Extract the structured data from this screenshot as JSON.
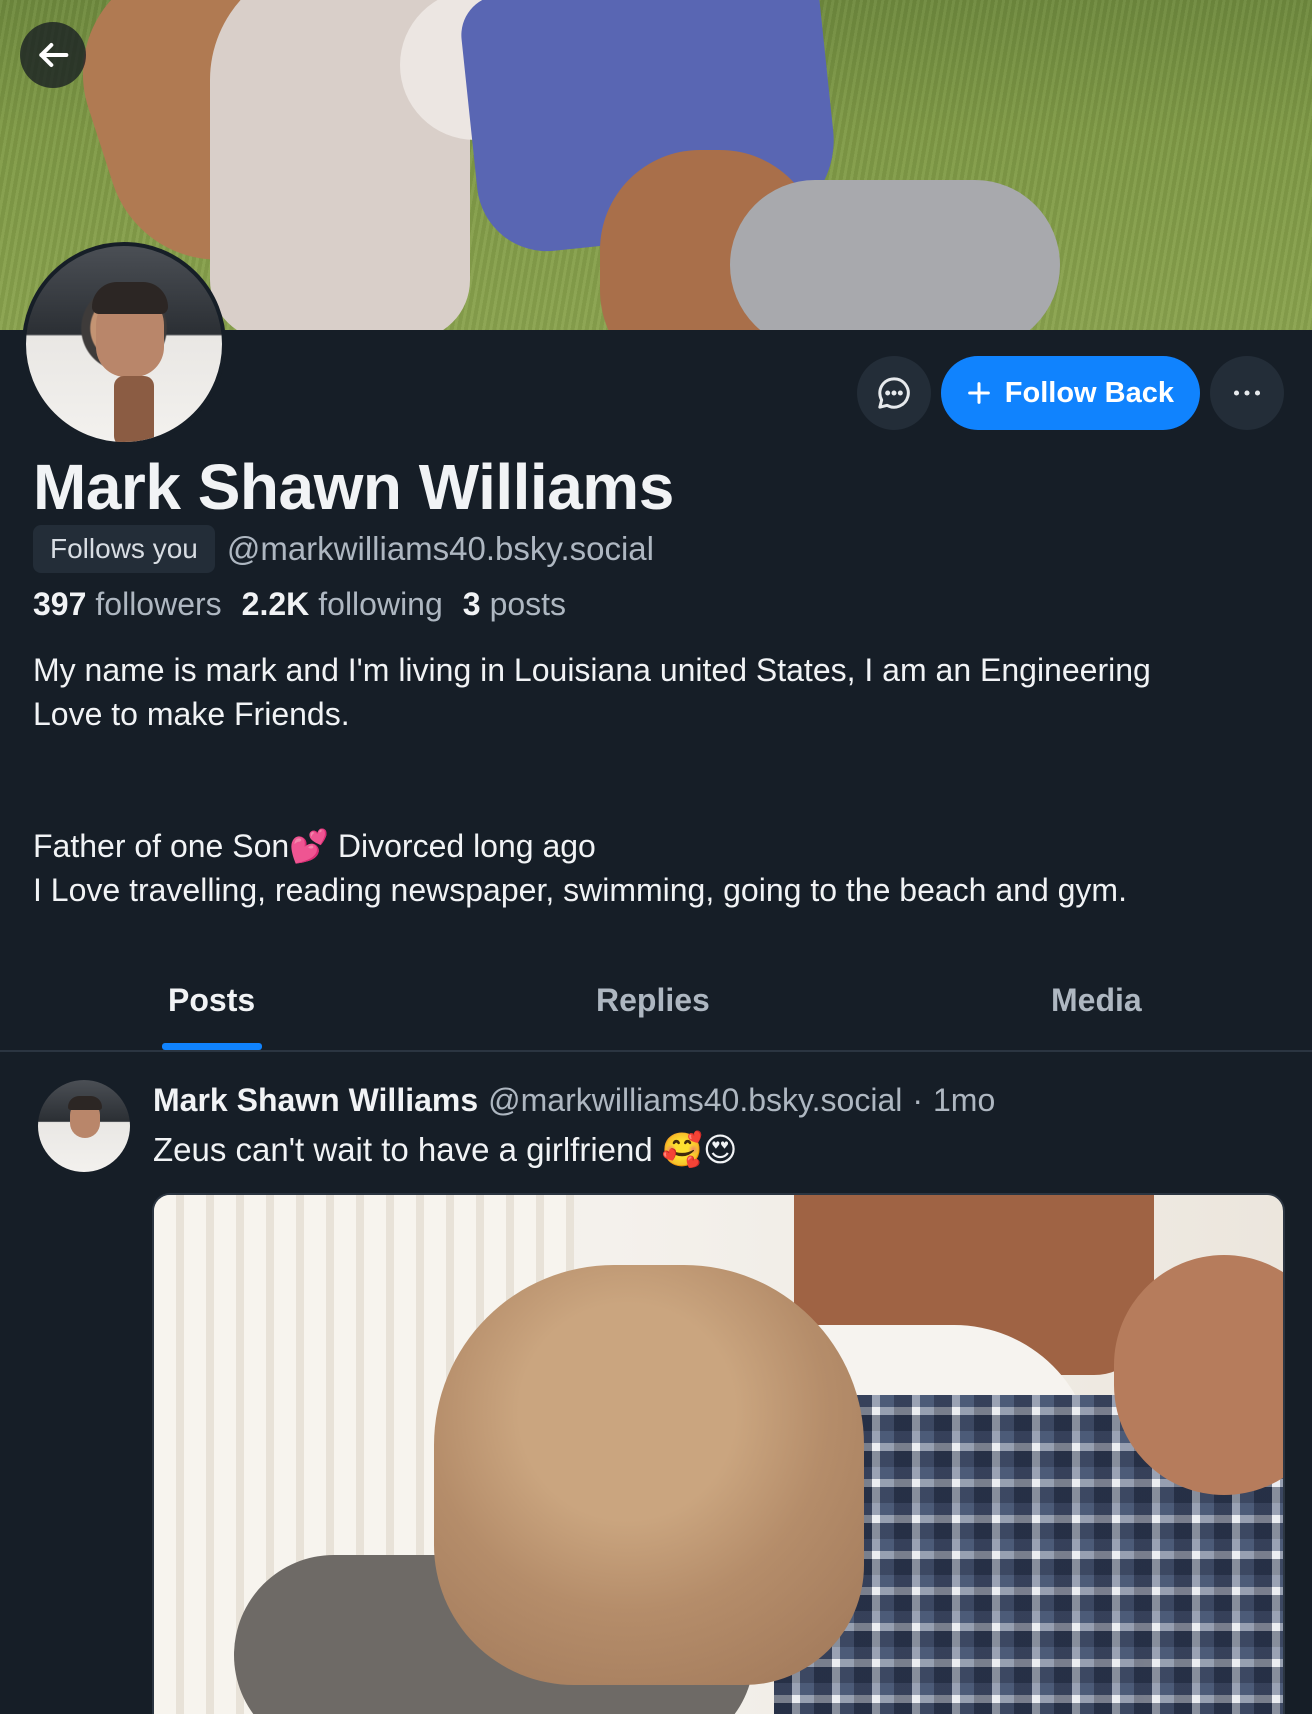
{
  "profile": {
    "display_name": "Mark Shawn Williams",
    "follows_you_label": "Follows you",
    "handle": "@markwilliams40.bsky.social",
    "followers_count": "397",
    "followers_label": "followers",
    "following_count": "2.2K",
    "following_label": "following",
    "posts_count": "3",
    "posts_label": "posts",
    "bio": "My name is mark and I'm living in Louisiana united States, I am an Engineering\nLove to make Friends.\n\n\nFather of one Son💕 Divorced long ago\nI Love travelling, reading newspaper, swimming, going to the beach and gym."
  },
  "actions": {
    "follow_back_label": "Follow Back",
    "message_icon": "chat-bubble-icon",
    "more_icon": "ellipsis-icon",
    "back_icon": "arrow-left-icon"
  },
  "tabs": [
    {
      "label": "Posts",
      "active": true
    },
    {
      "label": "Replies",
      "active": false
    },
    {
      "label": "Media",
      "active": false
    }
  ],
  "post": {
    "author": "Mark Shawn Williams",
    "handle": "@markwilliams40.bsky.social",
    "separator": "·",
    "time": "1mo",
    "text": "Zeus can't wait to have a girlfriend 🥰😍"
  },
  "colors": {
    "background": "#161e27",
    "accent": "#1083fe",
    "muted_text": "#aeb7c1",
    "chip_bg": "#232d38"
  }
}
